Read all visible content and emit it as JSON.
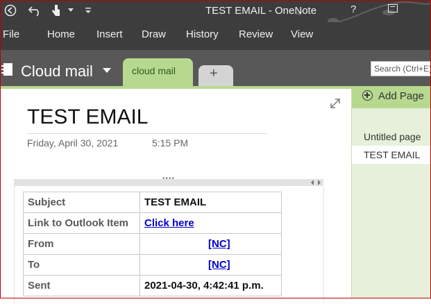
{
  "window": {
    "title": "TEST EMAIL - OneNote",
    "help_label": "?"
  },
  "quick_access": {
    "back_icon": "back-circle-icon",
    "undo_icon": "undo-icon",
    "touch_icon": "touch-mode-icon",
    "customize_icon": "customize-caret-icon"
  },
  "ribbon": {
    "tabs": [
      "File",
      "Home",
      "Insert",
      "Draw",
      "History",
      "Review",
      "View"
    ]
  },
  "notebook": {
    "name": "Cloud mail",
    "section_tab": "cloud mail",
    "add_section": "+",
    "search_placeholder": "Search (Ctrl+E)"
  },
  "page": {
    "title": "TEST EMAIL",
    "date": "Friday, April 30, 2021",
    "time": "5:15 PM"
  },
  "email_table": {
    "rows": [
      {
        "key": "Subject",
        "value": "TEST EMAIL"
      },
      {
        "key": "Link to Outlook Item",
        "value": "Click here"
      },
      {
        "key": "From",
        "value": "[NC]"
      },
      {
        "key": "To",
        "value": "[NC]"
      },
      {
        "key": "Sent",
        "value": "2021-04-30, 4:42:41 p.m."
      }
    ]
  },
  "page_list": {
    "add_page": "Add Page",
    "items": [
      "Untitled page",
      "TEST EMAIL"
    ],
    "selected": "TEST EMAIL"
  },
  "colors": {
    "titlebar": "#3d3d3d",
    "notebook_bar": "#585858",
    "section_green": "#b7d98f",
    "page_list_bg": "#e6f0da",
    "link": "#0000cc"
  }
}
